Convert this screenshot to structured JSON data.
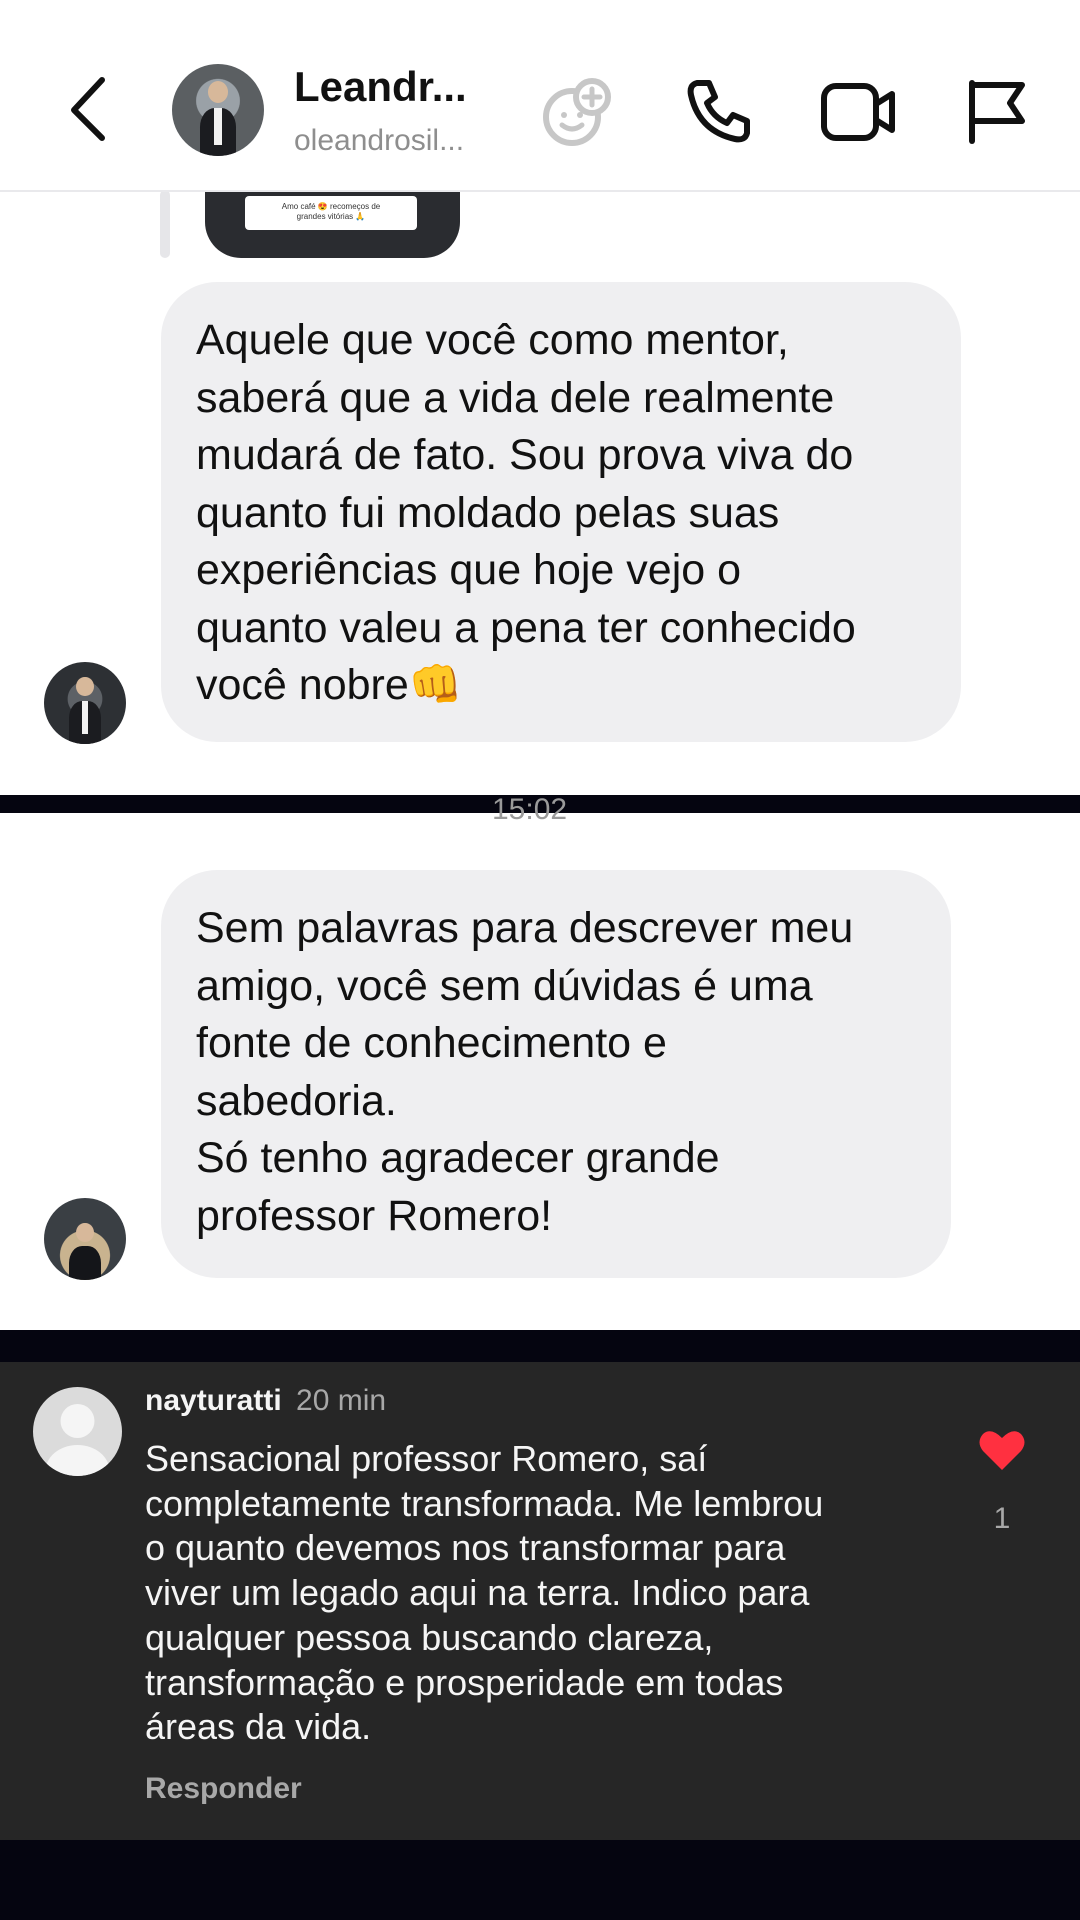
{
  "header": {
    "name": "Leandr...",
    "username": "oleandrosil..."
  },
  "shared_post": {
    "caption_line1": "Amo café 😍 recomeços de",
    "caption_line2": "grandes vitórias 🙏"
  },
  "message1": {
    "lines": [
      "Aquele que você como mentor,",
      "saberá que a vida dele realmente",
      "mudará de fato. Sou prova viva do",
      "quanto fui moldado pelas suas",
      "experiências que hoje vejo o",
      "quanto valeu a pena ter conhecido",
      "você nobre👊"
    ]
  },
  "timestamp_partial": "15:02",
  "message2": {
    "lines": [
      "Sem palavras para descrever meu",
      "amigo, você sem dúvidas é uma",
      "fonte de conhecimento e",
      "sabedoria.",
      "Só tenho agradecer grande",
      "professor Romero!"
    ]
  },
  "comment": {
    "username": "nayturatti",
    "time": "20 min",
    "lines": [
      "Sensacional professor Romero, saí",
      "completamente transformada. Me lembrou",
      "o quanto devemos nos transformar para",
      "viver um legado aqui na terra. Indico para",
      "qualquer pessoa buscando clareza,",
      "transformação e prosperidade em todas",
      "áreas da vida."
    ],
    "like_count": "1",
    "reply_label": "Responder",
    "like_color": "#ff3040"
  },
  "icons": {
    "back": "chevron-left-icon",
    "sticker": "sticker-add-icon",
    "call": "phone-icon",
    "video": "video-icon",
    "report": "flag-icon",
    "like": "heart-icon"
  }
}
